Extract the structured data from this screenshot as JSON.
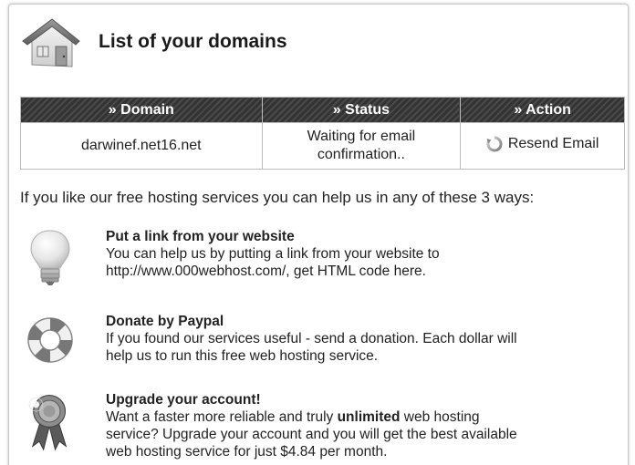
{
  "header": {
    "title": "List of your domains",
    "icon": "house-icon"
  },
  "table": {
    "columns": [
      "» Domain",
      "» Status",
      "» Action"
    ],
    "rows": [
      {
        "domain": "darwinef.net16.net",
        "status": "Waiting for email confirmation..",
        "action": "Resend Email"
      }
    ]
  },
  "intro": "If you like our free hosting services you can help us in any of these 3 ways:",
  "ways": [
    {
      "icon": "lightbulb-icon",
      "title": "Put a link from your website",
      "line1": "You can help us by putting a link from your website to",
      "line2": "http://www.000webhost.com/, get HTML code here."
    },
    {
      "icon": "lifebuoy-icon",
      "title": "Donate by Paypal",
      "line1": "If you found our services useful - send a donation. Each dollar will",
      "line2": "help us to run this free web hosting service."
    },
    {
      "icon": "award-ribbon-icon",
      "title": "Upgrade your account!",
      "line1_pre": "Want a faster more reliable and truly ",
      "line1_bold": "unlimited",
      "line1_post": " web hosting",
      "line2": "service? Upgrade your account and you will get the best available",
      "line3": "web hosting service for just $4.84 per month."
    }
  ]
}
